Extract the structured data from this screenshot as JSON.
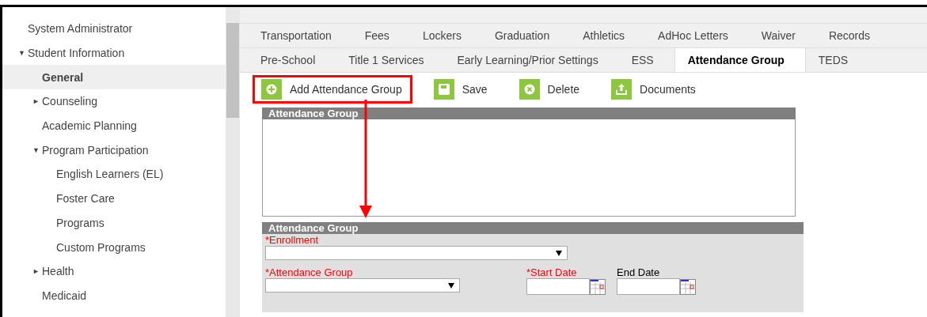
{
  "sidebar": {
    "items": [
      {
        "label": "System Administrator",
        "selected": false
      },
      {
        "label": "Student Information",
        "selected": false,
        "toggle": "▼",
        "children": [
          {
            "label": "General",
            "selected": true
          },
          {
            "label": "Counseling",
            "selected": false,
            "toggle": "►"
          },
          {
            "label": "Academic Planning",
            "selected": false
          },
          {
            "label": "Program Participation",
            "selected": false,
            "toggle": "▼",
            "children": [
              {
                "label": "English Learners (EL)",
                "selected": false
              },
              {
                "label": "Foster Care",
                "selected": false
              },
              {
                "label": "Programs",
                "selected": false
              },
              {
                "label": "Custom Programs",
                "selected": false
              }
            ]
          },
          {
            "label": "Health",
            "selected": false,
            "toggle": "►"
          },
          {
            "label": "Medicaid",
            "selected": false
          }
        ]
      }
    ]
  },
  "tab_rows": [
    [
      {
        "label": "Transportation",
        "selected": false
      },
      {
        "label": "Fees",
        "selected": false
      },
      {
        "label": "Lockers",
        "selected": false
      },
      {
        "label": "Graduation",
        "selected": false
      },
      {
        "label": "Athletics",
        "selected": false
      },
      {
        "label": "AdHoc Letters",
        "selected": false
      },
      {
        "label": "Waiver",
        "selected": false
      },
      {
        "label": "Records",
        "selected": false
      }
    ],
    [
      {
        "label": "Pre-School",
        "selected": false
      },
      {
        "label": "Title 1 Services",
        "selected": false
      },
      {
        "label": "Early Learning/Prior Settings",
        "selected": false
      },
      {
        "label": "ESS",
        "selected": false
      },
      {
        "label": "Attendance Group",
        "selected": true
      },
      {
        "label": "TEDS",
        "selected": false
      }
    ]
  ],
  "toolbar": [
    {
      "label": "Add Attendance Group",
      "kind": "add",
      "highlighted": true
    },
    {
      "label": "Save",
      "kind": "save",
      "highlighted": false
    },
    {
      "label": "Delete",
      "kind": "delete",
      "highlighted": false
    },
    {
      "label": "Documents",
      "kind": "documents",
      "highlighted": false
    }
  ],
  "list_panel": {
    "title": "Attendance Group"
  },
  "form": {
    "title": "Attendance Group",
    "rows": [
      [
        {
          "label": "*Enrollment",
          "kind": "select",
          "required": true
        }
      ],
      [
        {
          "label": "*Attendance Group",
          "kind": "select",
          "required": true
        },
        {
          "label": "*Start Date",
          "kind": "date",
          "required": true
        },
        {
          "label": "End Date",
          "kind": "date",
          "required": false
        }
      ]
    ]
  }
}
